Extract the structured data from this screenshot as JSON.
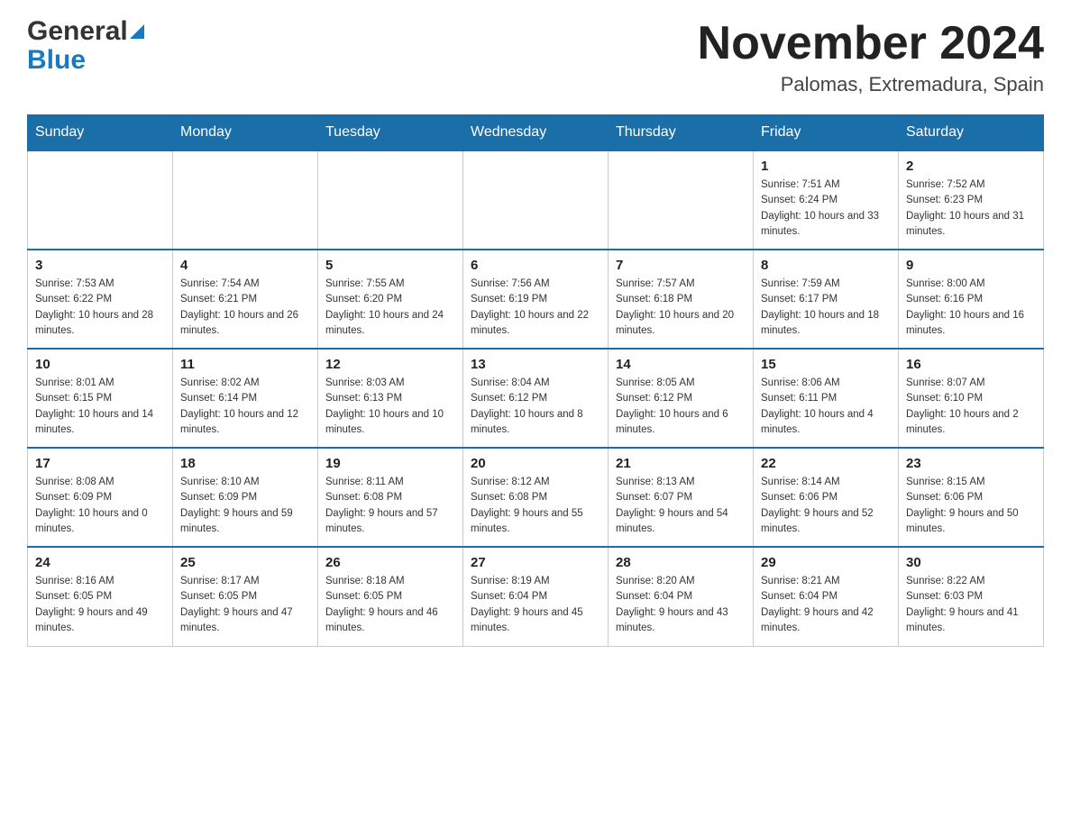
{
  "header": {
    "logo_general": "General",
    "logo_blue": "Blue",
    "month_title": "November 2024",
    "location": "Palomas, Extremadura, Spain"
  },
  "days_of_week": [
    "Sunday",
    "Monday",
    "Tuesday",
    "Wednesday",
    "Thursday",
    "Friday",
    "Saturday"
  ],
  "weeks": [
    [
      {
        "day": "",
        "info": ""
      },
      {
        "day": "",
        "info": ""
      },
      {
        "day": "",
        "info": ""
      },
      {
        "day": "",
        "info": ""
      },
      {
        "day": "",
        "info": ""
      },
      {
        "day": "1",
        "info": "Sunrise: 7:51 AM\nSunset: 6:24 PM\nDaylight: 10 hours and 33 minutes."
      },
      {
        "day": "2",
        "info": "Sunrise: 7:52 AM\nSunset: 6:23 PM\nDaylight: 10 hours and 31 minutes."
      }
    ],
    [
      {
        "day": "3",
        "info": "Sunrise: 7:53 AM\nSunset: 6:22 PM\nDaylight: 10 hours and 28 minutes."
      },
      {
        "day": "4",
        "info": "Sunrise: 7:54 AM\nSunset: 6:21 PM\nDaylight: 10 hours and 26 minutes."
      },
      {
        "day": "5",
        "info": "Sunrise: 7:55 AM\nSunset: 6:20 PM\nDaylight: 10 hours and 24 minutes."
      },
      {
        "day": "6",
        "info": "Sunrise: 7:56 AM\nSunset: 6:19 PM\nDaylight: 10 hours and 22 minutes."
      },
      {
        "day": "7",
        "info": "Sunrise: 7:57 AM\nSunset: 6:18 PM\nDaylight: 10 hours and 20 minutes."
      },
      {
        "day": "8",
        "info": "Sunrise: 7:59 AM\nSunset: 6:17 PM\nDaylight: 10 hours and 18 minutes."
      },
      {
        "day": "9",
        "info": "Sunrise: 8:00 AM\nSunset: 6:16 PM\nDaylight: 10 hours and 16 minutes."
      }
    ],
    [
      {
        "day": "10",
        "info": "Sunrise: 8:01 AM\nSunset: 6:15 PM\nDaylight: 10 hours and 14 minutes."
      },
      {
        "day": "11",
        "info": "Sunrise: 8:02 AM\nSunset: 6:14 PM\nDaylight: 10 hours and 12 minutes."
      },
      {
        "day": "12",
        "info": "Sunrise: 8:03 AM\nSunset: 6:13 PM\nDaylight: 10 hours and 10 minutes."
      },
      {
        "day": "13",
        "info": "Sunrise: 8:04 AM\nSunset: 6:12 PM\nDaylight: 10 hours and 8 minutes."
      },
      {
        "day": "14",
        "info": "Sunrise: 8:05 AM\nSunset: 6:12 PM\nDaylight: 10 hours and 6 minutes."
      },
      {
        "day": "15",
        "info": "Sunrise: 8:06 AM\nSunset: 6:11 PM\nDaylight: 10 hours and 4 minutes."
      },
      {
        "day": "16",
        "info": "Sunrise: 8:07 AM\nSunset: 6:10 PM\nDaylight: 10 hours and 2 minutes."
      }
    ],
    [
      {
        "day": "17",
        "info": "Sunrise: 8:08 AM\nSunset: 6:09 PM\nDaylight: 10 hours and 0 minutes."
      },
      {
        "day": "18",
        "info": "Sunrise: 8:10 AM\nSunset: 6:09 PM\nDaylight: 9 hours and 59 minutes."
      },
      {
        "day": "19",
        "info": "Sunrise: 8:11 AM\nSunset: 6:08 PM\nDaylight: 9 hours and 57 minutes."
      },
      {
        "day": "20",
        "info": "Sunrise: 8:12 AM\nSunset: 6:08 PM\nDaylight: 9 hours and 55 minutes."
      },
      {
        "day": "21",
        "info": "Sunrise: 8:13 AM\nSunset: 6:07 PM\nDaylight: 9 hours and 54 minutes."
      },
      {
        "day": "22",
        "info": "Sunrise: 8:14 AM\nSunset: 6:06 PM\nDaylight: 9 hours and 52 minutes."
      },
      {
        "day": "23",
        "info": "Sunrise: 8:15 AM\nSunset: 6:06 PM\nDaylight: 9 hours and 50 minutes."
      }
    ],
    [
      {
        "day": "24",
        "info": "Sunrise: 8:16 AM\nSunset: 6:05 PM\nDaylight: 9 hours and 49 minutes."
      },
      {
        "day": "25",
        "info": "Sunrise: 8:17 AM\nSunset: 6:05 PM\nDaylight: 9 hours and 47 minutes."
      },
      {
        "day": "26",
        "info": "Sunrise: 8:18 AM\nSunset: 6:05 PM\nDaylight: 9 hours and 46 minutes."
      },
      {
        "day": "27",
        "info": "Sunrise: 8:19 AM\nSunset: 6:04 PM\nDaylight: 9 hours and 45 minutes."
      },
      {
        "day": "28",
        "info": "Sunrise: 8:20 AM\nSunset: 6:04 PM\nDaylight: 9 hours and 43 minutes."
      },
      {
        "day": "29",
        "info": "Sunrise: 8:21 AM\nSunset: 6:04 PM\nDaylight: 9 hours and 42 minutes."
      },
      {
        "day": "30",
        "info": "Sunrise: 8:22 AM\nSunset: 6:03 PM\nDaylight: 9 hours and 41 minutes."
      }
    ]
  ]
}
